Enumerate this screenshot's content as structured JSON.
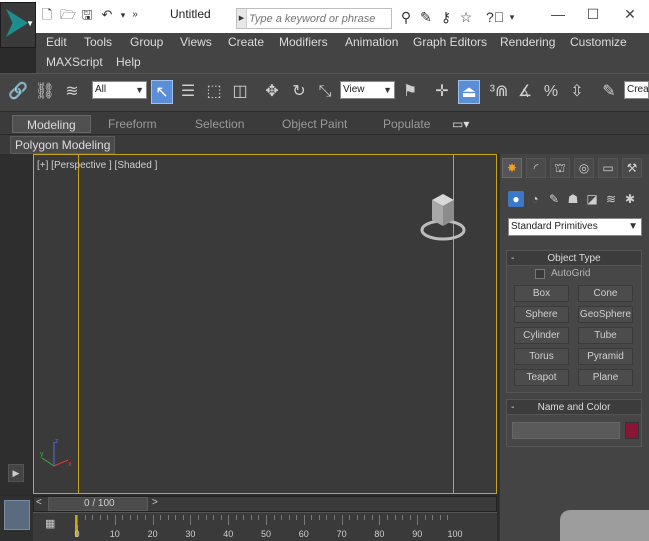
{
  "titlebar": {
    "title": "Untitled",
    "search_placeholder": "Type a keyword or phrase"
  },
  "menu": {
    "row1": [
      "Edit",
      "Tools",
      "Group",
      "Views",
      "Create",
      "Modifiers",
      "Animation",
      "Graph Editors",
      "Rendering",
      "Customize"
    ],
    "row2": [
      "MAXScript",
      "Help"
    ]
  },
  "toolbar": {
    "selection_filter": "All",
    "reference_coord": "View",
    "create_selection_set": "Crea"
  },
  "ribbon": {
    "tabs": [
      "Modeling",
      "Freeform",
      "Selection",
      "Object Paint",
      "Populate"
    ],
    "active_tab": "Modeling",
    "sub_tab": "Polygon Modeling"
  },
  "viewport": {
    "label": "[+] [Perspective ] [Shaded ]"
  },
  "command_panel": {
    "primitive_type": "Standard Primitives",
    "object_type_title": "Object Type",
    "autogrid_label": "AutoGrid",
    "autogrid_checked": false,
    "buttons": [
      "Box",
      "Cone",
      "Sphere",
      "GeoSphere",
      "Cylinder",
      "Tube",
      "Torus",
      "Pyramid",
      "Teapot",
      "Plane"
    ],
    "name_color_title": "Name and Color",
    "name_value": "",
    "object_color": "#8a1534"
  },
  "timeline": {
    "frame_label": "0 / 100",
    "ticks": [
      "0",
      "10",
      "20",
      "30",
      "40",
      "50",
      "60",
      "70",
      "80",
      "90",
      "100"
    ]
  },
  "colors": {
    "viewport_border": "#c8a419",
    "active_blue": "#5a8ed6"
  }
}
